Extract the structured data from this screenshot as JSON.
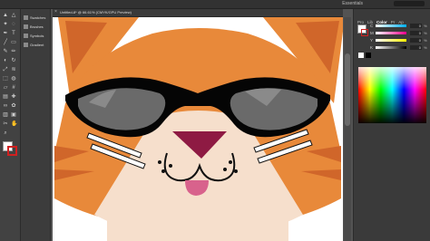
{
  "menubar": {
    "workspace_label": "Essentials"
  },
  "toolbar": {
    "tools": [
      "selection-tool",
      "direct-selection-tool",
      "magic-wand-tool",
      "lasso-tool",
      "pen-tool",
      "type-tool",
      "line-tool",
      "rectangle-tool",
      "paintbrush-tool",
      "pencil-tool",
      "eraser-tool",
      "rotate-tool",
      "scale-tool",
      "width-tool",
      "free-transform-tool",
      "shape-builder-tool",
      "perspective-tool",
      "mesh-tool",
      "gradient-tool",
      "eyedropper-tool",
      "blend-tool",
      "symbol-sprayer-tool",
      "graph-tool",
      "artboard-tool",
      "slice-tool",
      "hand-tool",
      "zoom-tool"
    ]
  },
  "dock": {
    "items": [
      "Swatches",
      "Brushes",
      "Symbols",
      "Gradient"
    ]
  },
  "document": {
    "tab_title": "Untitled-8* @ 66.61% (CMYK/GPU Preview)"
  },
  "right_panel": {
    "tabs": [
      "Pro",
      "Lib",
      "Color",
      "Pr",
      "Ap"
    ],
    "active_tab": "Color",
    "sliders": [
      {
        "letter": "C",
        "value": "0",
        "unit": "%",
        "gradient": "linear-gradient(to right,#fff,#00aeef)"
      },
      {
        "letter": "M",
        "value": "0",
        "unit": "%",
        "gradient": "linear-gradient(to right,#fff,#ec008c)"
      },
      {
        "letter": "Y",
        "value": "0",
        "unit": "%",
        "gradient": "linear-gradient(to right,#fff,#fff200)"
      },
      {
        "letter": "K",
        "value": "0",
        "unit": "%",
        "gradient": "linear-gradient(to right,#fff,#000)"
      }
    ]
  },
  "colors": {
    "cat_orange": "#e8893a",
    "cat_orange_dark": "#d0662a",
    "cream": "#f6dfcc",
    "nose": "#8e1a43",
    "tongue": "#d8628c",
    "lens": "#6a6a6a",
    "frame": "#050505"
  }
}
